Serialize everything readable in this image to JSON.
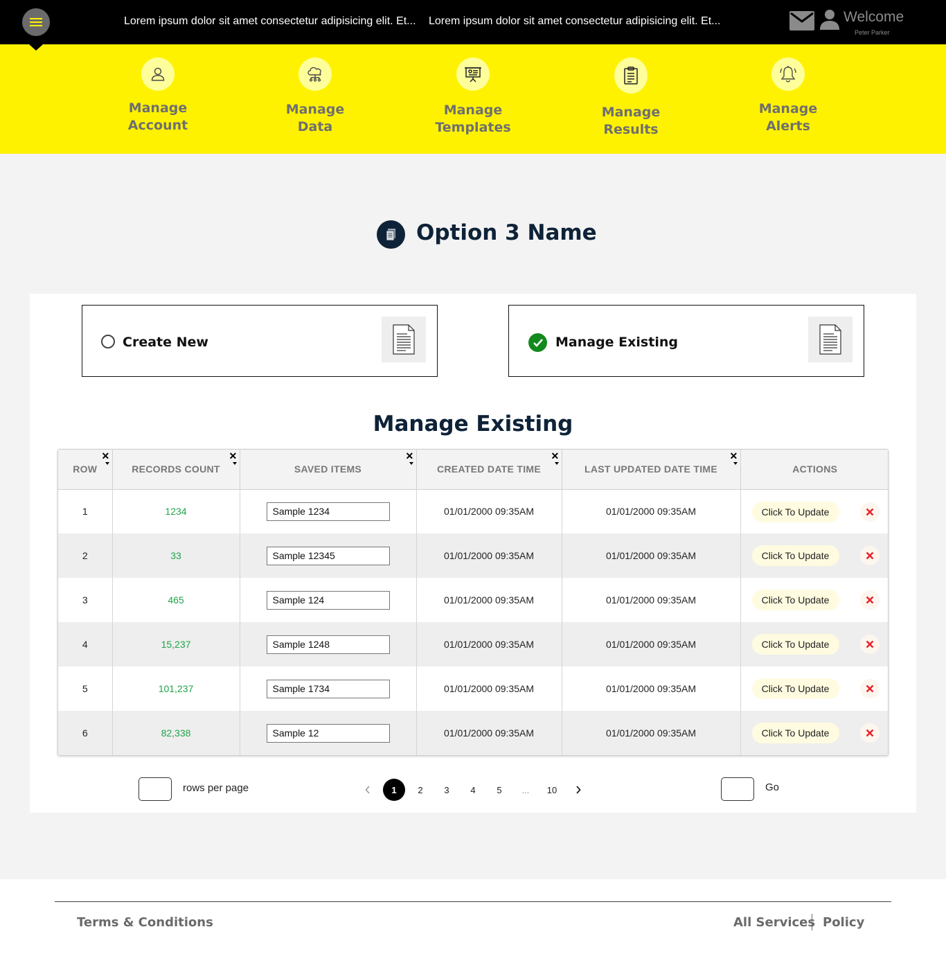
{
  "header": {
    "ticker": [
      "Lorem ipsum dolor sit amet consectetur adipisicing elit. Et...",
      "Lorem ipsum dolor sit amet consectetur adipisicing elit. Et..."
    ],
    "welcome": "Welcome",
    "username": "Peter Parker",
    "icons": [
      "menu-icon",
      "mail-icon",
      "user-icon"
    ]
  },
  "nav": {
    "items": [
      {
        "label_1": "Manage",
        "label_2": "Account",
        "icon": "user-icon"
      },
      {
        "label_1": "Manage",
        "label_2": "Data",
        "icon": "cloud-network-icon"
      },
      {
        "label_1": "Manage",
        "label_2": "Templates",
        "icon": "presentation-icon"
      },
      {
        "label_1": "Manage",
        "label_2": "Results",
        "icon": "clipboard-icon"
      },
      {
        "label_1": "Manage",
        "label_2": "Alerts",
        "icon": "bell-icon"
      }
    ]
  },
  "page": {
    "title": "Option 3 Name",
    "title_icon": "document-icon"
  },
  "options": {
    "create_new": {
      "label": "Create New",
      "selected": false
    },
    "manage_existing": {
      "label": "Manage Existing",
      "selected": true
    }
  },
  "section_title": "Manage Existing",
  "table": {
    "columns": [
      "ROW",
      "RECORDS COUNT",
      "SAVED ITEMS",
      "CREATED DATE TIME",
      "LAST UPDATED DATE TIME",
      "ACTIONS"
    ],
    "rows": [
      {
        "row": "1",
        "count": "1234",
        "saved": "Sample 1234",
        "created": "01/01/2000 09:35AM",
        "updated": "01/01/2000 09:35AM",
        "action": "Click To Update"
      },
      {
        "row": "2",
        "count": "33",
        "saved": "Sample 12345",
        "created": "01/01/2000 09:35AM",
        "updated": "01/01/2000 09:35AM",
        "action": "Click To Update"
      },
      {
        "row": "3",
        "count": "465",
        "saved": "Sample 124",
        "created": "01/01/2000 09:35AM",
        "updated": "01/01/2000 09:35AM",
        "action": "Click To Update"
      },
      {
        "row": "4",
        "count": "15,237",
        "saved": "Sample 1248",
        "created": "01/01/2000 09:35AM",
        "updated": "01/01/2000 09:35AM",
        "action": "Click To Update"
      },
      {
        "row": "5",
        "count": "101,237",
        "saved": "Sample 1734",
        "created": "01/01/2000 09:35AM",
        "updated": "01/01/2000 09:35AM",
        "action": "Click To Update"
      },
      {
        "row": "6",
        "count": "82,338",
        "saved": "Sample 12",
        "created": "01/01/2000 09:35AM",
        "updated": "01/01/2000 09:35AM",
        "action": "Click To Update"
      }
    ]
  },
  "pagination": {
    "rows_per_page_label": "rows per page",
    "rows_per_page_value": "",
    "pages": [
      "1",
      "2",
      "3",
      "4",
      "5",
      "...",
      "10"
    ],
    "current_page": "1",
    "go_value": "",
    "go_label": "Go"
  },
  "footer": {
    "terms": "Terms & Conditions",
    "all_services": "All Services",
    "policy": "Policy"
  },
  "colors": {
    "accent_yellow": "#fff200",
    "navy": "#0e2238",
    "count_green": "#1fa34a",
    "check_green": "#138a1e",
    "delete_red": "#e8212a"
  }
}
